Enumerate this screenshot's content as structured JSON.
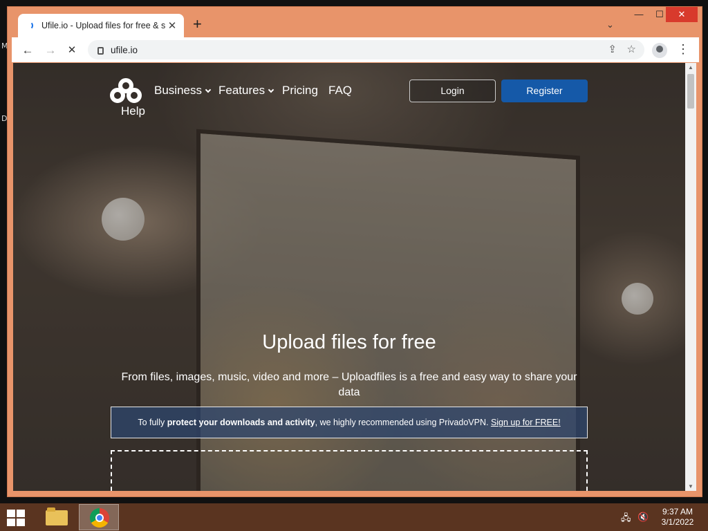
{
  "desktop": {
    "frag_top": "M",
    "frag_mid": "D"
  },
  "browser": {
    "tab_title": "Ufile.io - Upload files for free & s",
    "tab_close": "✕",
    "new_tab": "+",
    "url": "ufile.io",
    "window_controls": {
      "minimize": "—",
      "maximize": "☐",
      "close": "✕"
    },
    "icons": {
      "back": "←",
      "forward": "→",
      "stop": "✕",
      "share": "⇪",
      "star": "☆",
      "menu": "⋮",
      "tab_search": "⌄"
    }
  },
  "site": {
    "nav": {
      "help": "Help",
      "business": "Business",
      "features": "Features",
      "pricing": "Pricing",
      "faq": "FAQ",
      "login": "Login",
      "register": "Register"
    },
    "hero": {
      "title": "Upload files for free",
      "subtitle": "From files, images, music, video and more – Uploadfiles is a free and easy way to share your data"
    },
    "vpn_banner": {
      "part1": "To fully ",
      "bold": "protect your downloads and activity",
      "part2": ", we highly recommended using PrivadoVPN. ",
      "link": "Sign up for FREE!"
    },
    "colors": {
      "register_bg": "#1559a8",
      "accent": "#1a73e8"
    }
  },
  "scrollbar": {
    "up": "▲",
    "down": "▼"
  },
  "taskbar": {
    "clock_time": "9:37 AM",
    "clock_date": "3/1/2022",
    "icons": {
      "network": "🖧",
      "volume": "🔇"
    }
  }
}
